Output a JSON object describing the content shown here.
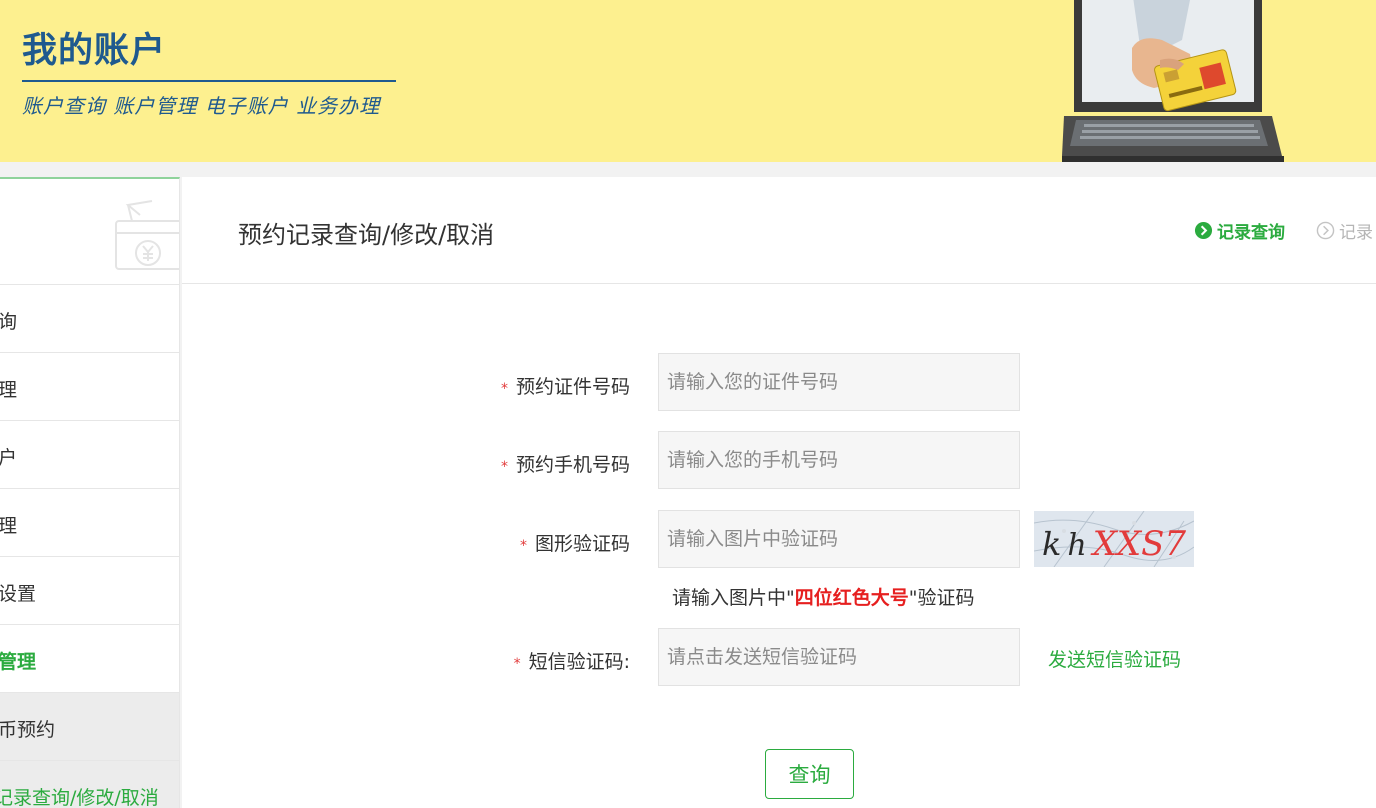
{
  "header": {
    "title": "我的账户",
    "subtitle": "账户查询 账户管理 电子账户 业务办理"
  },
  "sidebar": {
    "title": "",
    "items": [
      {
        "label": "询"
      },
      {
        "label": "理"
      },
      {
        "label": "户"
      },
      {
        "label": "理"
      },
      {
        "label": "设置"
      },
      {
        "label": "管理"
      },
      {
        "label": "币预约"
      },
      {
        "label": "记录查询/修改/取消"
      }
    ]
  },
  "main": {
    "title": "预约记录查询/修改/取消",
    "steps": [
      {
        "label": "记录查询"
      },
      {
        "label": "记录"
      }
    ]
  },
  "form": {
    "required_mark": "*",
    "id_label": "预约证件号码",
    "id_placeholder": "请输入您的证件号码",
    "phone_label": "预约手机号码",
    "phone_placeholder": "请输入您的手机号码",
    "captcha_label": "图形验证码",
    "captcha_placeholder": "请输入图片中验证码",
    "captcha_text": "khXXS7",
    "captcha_hint_pre": "请输入图片中\"",
    "captcha_hint_emph": "四位红色大号",
    "captcha_hint_post": "\"验证码",
    "sms_label": "短信验证码:",
    "sms_placeholder": "请点击发送短信验证码",
    "send_sms_label": "发送短信验证码",
    "query_label": "查询"
  },
  "colors": {
    "header_bg": "#fdf08f",
    "brand_blue": "#1f5a8f",
    "accent_green": "#2bab3f",
    "required_red": "#e23b3b"
  }
}
